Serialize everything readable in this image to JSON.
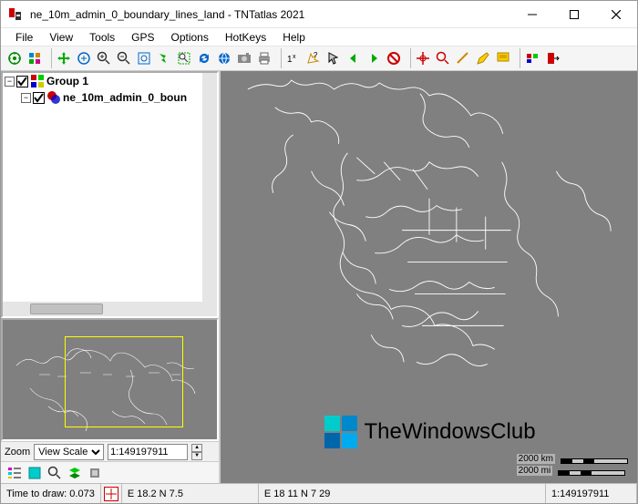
{
  "window": {
    "title": "ne_10m_admin_0_boundary_lines_land - TNTatlas 2021"
  },
  "menu": {
    "file": "File",
    "view": "View",
    "tools": "Tools",
    "gps": "GPS",
    "options": "Options",
    "hotkeys": "HotKeys",
    "help": "Help"
  },
  "tree": {
    "group": {
      "label": "Group 1",
      "expanded": true,
      "checked": true
    },
    "layer": {
      "label": "ne_10m_admin_0_boun",
      "checked": true
    }
  },
  "zoom": {
    "label": "Zoom",
    "select_value": "View Scale",
    "scale_value": "1:149197911"
  },
  "scalebar": {
    "km": "2000 km",
    "mi": "2000 mi"
  },
  "status": {
    "draw_time_label": "Time to draw:",
    "draw_time_value": "0.073",
    "coord1": "E 18.2  N 7.5",
    "coord2": "E 18 11  N 7 29",
    "scale": "1:149197911"
  },
  "watermark": {
    "text": "TheWindowsClub"
  }
}
